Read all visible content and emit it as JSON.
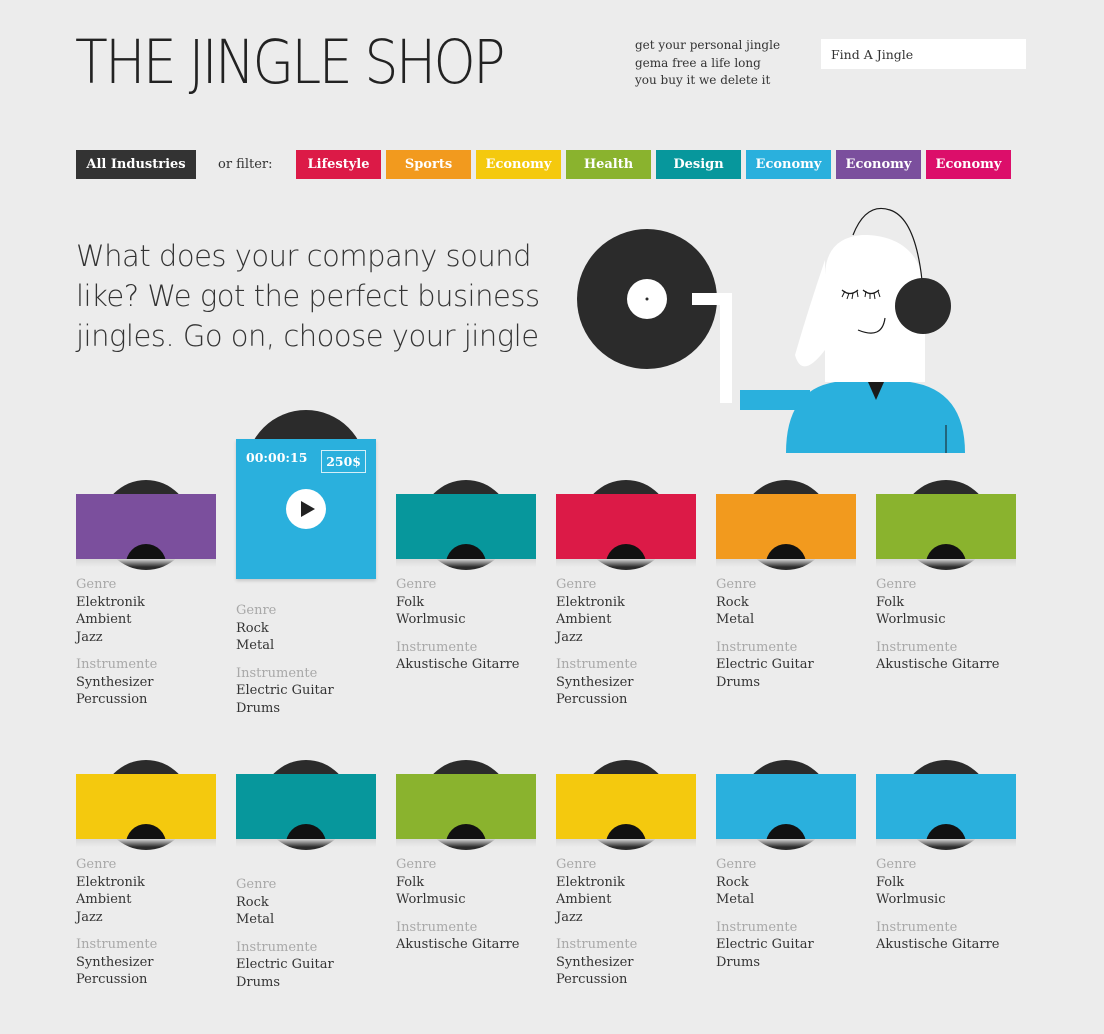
{
  "header": {
    "logo": "THE JINGLE SHOP",
    "tagline": [
      "get your personal jingle",
      "gema free a life long",
      "you buy it we delete it"
    ],
    "search_placeholder": "Find A Jingle"
  },
  "filters": {
    "all_label": "All Industries",
    "or_label": "or filter:",
    "items": [
      {
        "label": "Lifestyle",
        "color": "#dc1a47"
      },
      {
        "label": "Sports",
        "color": "#f29a1e"
      },
      {
        "label": "Economy",
        "color": "#f4c90e"
      },
      {
        "label": "Health",
        "color": "#8ab32e"
      },
      {
        "label": "Design",
        "color": "#07979c"
      },
      {
        "label": "Economy",
        "color": "#2ab0dd"
      },
      {
        "label": "Economy",
        "color": "#7b4f9d"
      },
      {
        "label": "Economy",
        "color": "#dc0e6a"
      }
    ]
  },
  "hero": {
    "headline": "What does your company sound like? We got the perfect business jingles. Go on, choose your jingle"
  },
  "labels": {
    "genre": "Genre",
    "instruments": "Instrumente"
  },
  "rows": [
    [
      {
        "color": "#7b4f9d",
        "genres": [
          "Elektronik",
          "Ambient",
          "Jazz"
        ],
        "instruments": [
          "Synthesizer",
          "Percussion"
        ]
      },
      {
        "color": "#2ab0dd",
        "active": true,
        "time": "00:00:15",
        "price": "250$",
        "genres": [
          "Rock",
          "Metal"
        ],
        "instruments": [
          "Electric Guitar",
          "Drums"
        ]
      },
      {
        "color": "#07979c",
        "genres": [
          "Folk",
          "Worlmusic"
        ],
        "instruments": [
          "Akustische Gitarre"
        ]
      },
      {
        "color": "#dc1a47",
        "genres": [
          "Elektronik",
          "Ambient",
          "Jazz"
        ],
        "instruments": [
          "Synthesizer",
          "Percussion"
        ]
      },
      {
        "color": "#f29a1e",
        "genres": [
          "Rock",
          "Metal"
        ],
        "instruments": [
          "Electric Guitar",
          "Drums"
        ]
      },
      {
        "color": "#8ab32e",
        "genres": [
          "Folk",
          "Worlmusic"
        ],
        "instruments": [
          "Akustische Gitarre"
        ]
      }
    ],
    [
      {
        "color": "#f4c90e",
        "genres": [
          "Elektronik",
          "Ambient",
          "Jazz"
        ],
        "instruments": [
          "Synthesizer",
          "Percussion"
        ]
      },
      {
        "color": "#07979c",
        "offset": true,
        "genres": [
          "Rock",
          "Metal"
        ],
        "instruments": [
          "Electric Guitar",
          "Drums"
        ]
      },
      {
        "color": "#8ab32e",
        "genres": [
          "Folk",
          "Worlmusic"
        ],
        "instruments": [
          "Akustische Gitarre"
        ]
      },
      {
        "color": "#f4c90e",
        "genres": [
          "Elektronik",
          "Ambient",
          "Jazz"
        ],
        "instruments": [
          "Synthesizer",
          "Percussion"
        ]
      },
      {
        "color": "#2ab0dd",
        "genres": [
          "Rock",
          "Metal"
        ],
        "instruments": [
          "Electric Guitar",
          "Drums"
        ]
      },
      {
        "color": "#2ab0dd",
        "genres": [
          "Folk",
          "Worlmusic"
        ],
        "instruments": [
          "Akustische Gitarre"
        ]
      }
    ]
  ]
}
